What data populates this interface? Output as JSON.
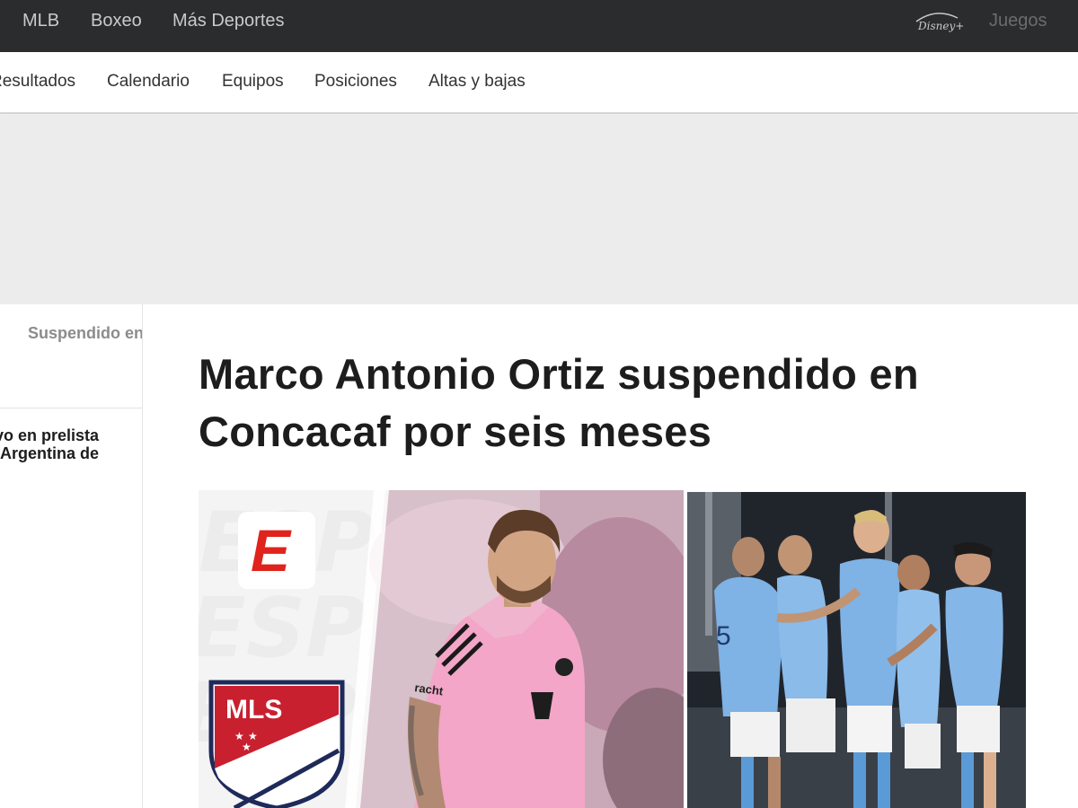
{
  "topnav": {
    "items": [
      "MLB",
      "Boxeo",
      "Más Deportes"
    ],
    "disney_logo": "Disney+",
    "juegos": "Juegos"
  },
  "subnav": {
    "items": [
      "Resultados",
      "Calendario",
      "Equipos",
      "Posiciones",
      "Altas y bajas"
    ]
  },
  "left_rail": {
    "story1": "Suspendido en",
    "story2_line1": "Messi, baja de nuevo en prelista",
    "story2_line2": "de Argentina de"
  },
  "article": {
    "headline": "Marco Antonio Ortiz suspendido en Concacaf por seis meses"
  },
  "hero": {
    "brand_mark": "E",
    "league_badge": "MLS",
    "jersey_sponsor": "racht"
  },
  "colors": {
    "topnav_bg": "#2b2c2d",
    "espn_red": "#e0231c",
    "mls_red": "#c8202f",
    "mls_navy": "#1e2a5a",
    "pink_jersey": "#f3a6c8",
    "sky_blue_jersey": "#7fb2e5"
  }
}
